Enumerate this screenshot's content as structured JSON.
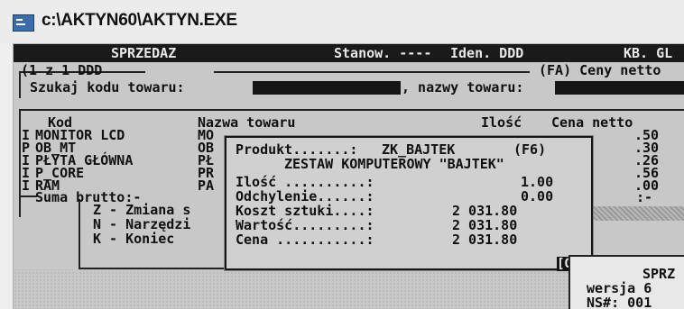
{
  "window": {
    "title": "c:\\AKTYN60\\AKTYN.EXE",
    "icon": "console-app-icon"
  },
  "header_bar": {
    "module": "SPRZEDAZ",
    "station": "Stanow. ----",
    "ident": "Iden. DDD",
    "kb": "KB. GL"
  },
  "panel_header": {
    "position": "(1 z 1 DDD",
    "mode": "(FA) Ceny netto"
  },
  "search": {
    "code_label": "Szukaj kodu towaru:",
    "name_label": ", nazwy towaru:"
  },
  "table": {
    "columns": [
      "Kod",
      "Nazwa towaru",
      "Ilość",
      "Cena netto"
    ],
    "rows": [
      {
        "flag": "I",
        "code": "MONITOR LCD",
        "name": "MO",
        "price": ".50"
      },
      {
        "flag": "P",
        "code": "OB_MT",
        "name": "OB",
        "price": ".30"
      },
      {
        "flag": "I",
        "code": "PŁYTA GŁÓWNA",
        "name": "PŁ",
        "price": ".26"
      },
      {
        "flag": "I",
        "code": "P_CORE",
        "name": "PR",
        "price": ".56"
      },
      {
        "flag": "I",
        "code": "RAM",
        "name": "PA",
        "price": ".00"
      }
    ],
    "sum_label": "Suma brutto:-",
    "sum_value": ":-"
  },
  "menu": {
    "items": [
      {
        "key": "Z",
        "label": "Z - Zmiana s"
      },
      {
        "key": "N",
        "label": "N - Narzędzi"
      },
      {
        "key": "K",
        "label": "K - Koniec"
      }
    ]
  },
  "product_popup": {
    "product_label": "Produkt.......:",
    "product_code": "ZK_BAJTEK",
    "shortcut": "(F6)",
    "product_name": "ZESTAW KOMPUTEROWY \"BAJTEK\"",
    "fields": [
      {
        "label": "Ilość ..........:",
        "value": "1.00"
      },
      {
        "label": "Odchylenie......:",
        "value": "0.00"
      },
      {
        "label": "Koszt sztuki....:",
        "value": "2 031.80"
      },
      {
        "label": "Wartość.........:",
        "value": "2 031.80"
      },
      {
        "label": "Cena ...........:",
        "value": "2 031.80"
      }
    ],
    "ok_label": "[OK]"
  },
  "info_box": {
    "line1": "SPRZ",
    "line2": "wersja 6",
    "line3": "NS#: 001"
  },
  "colors": {
    "console_bg": "#c8c8c8",
    "text": "#101010",
    "bar": "#1a1a1a"
  }
}
